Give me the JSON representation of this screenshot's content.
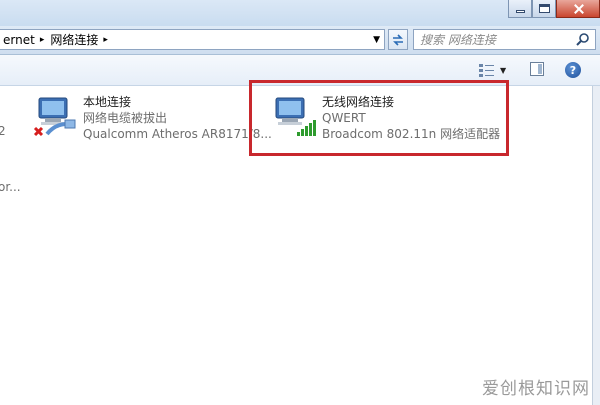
{
  "address": {
    "crumbs": [
      "ernet",
      "网络连接"
    ],
    "separator": "▸"
  },
  "search": {
    "placeholder": "搜索 网络连接"
  },
  "connections": [
    {
      "name": "本地连接",
      "status": "网络电缆被拔出",
      "adapter": "Qualcomm Atheros AR8171/8...",
      "icon": "wired-disconnected-icon"
    },
    {
      "name": "无线网络连接",
      "status": "QWERT",
      "adapter": "Broadcom 802.11n 网络适配器",
      "icon": "wireless-signal-icon"
    }
  ],
  "left_fragments": [
    "2",
    "or..."
  ],
  "colors": {
    "highlight": "#c8282d",
    "accent": "#2a6bb5"
  },
  "help_label": "?",
  "watermark": "爱创根知识网"
}
